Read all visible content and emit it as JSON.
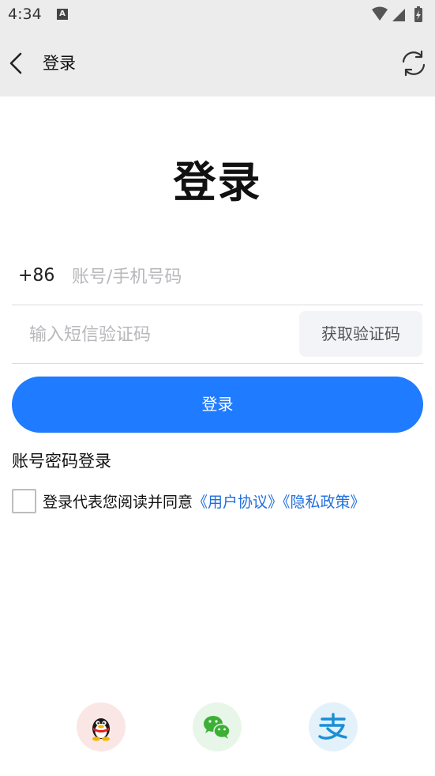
{
  "status_bar": {
    "time": "4:34",
    "notification_glyph": "A"
  },
  "app_bar": {
    "title": "登录"
  },
  "heading": "登录",
  "phone": {
    "country_code": "+86",
    "placeholder": "账号/手机号码"
  },
  "sms": {
    "placeholder": "输入短信验证码",
    "get_code_label": "获取验证码"
  },
  "login_label": "登录",
  "password_login_label": "账号密码登录",
  "agreement": {
    "prefix": "登录代表您阅读并同意",
    "user_agreement": "《用户协议》",
    "privacy_policy": "《隐私政策》"
  },
  "colors": {
    "accent": "#1f7bff",
    "link": "#1f6fe0",
    "app_bar_bg": "#ececec"
  },
  "social_icons": [
    "qq-icon",
    "wechat-icon",
    "alipay-icon"
  ]
}
